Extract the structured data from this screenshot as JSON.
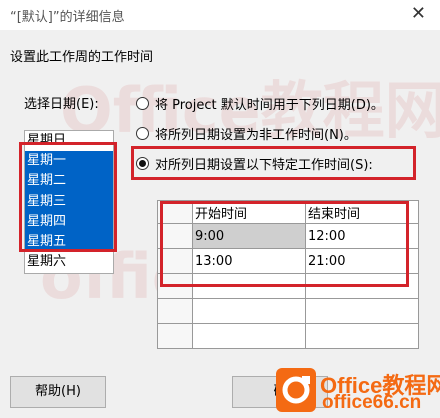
{
  "window": {
    "title": "“[默认]”的详细信息",
    "close_glyph": "✕"
  },
  "watermark": {
    "line1": "Office教程网",
    "line2": "office66.cn"
  },
  "heading": "设置此工作周的工作时间",
  "select_days_label": "选择日期(E):",
  "days": [
    "星期日",
    "星期一",
    "星期二",
    "星期三",
    "星期四",
    "星期五",
    "星期六"
  ],
  "selected_days": [
    "星期一",
    "星期二",
    "星期三",
    "星期四",
    "星期五"
  ],
  "options": [
    {
      "label": "将 Project 默认时间用于下列日期(D)。",
      "selected": false
    },
    {
      "label": "将所列日期设置为非工作时间(N)。",
      "selected": false
    },
    {
      "label": "对所列日期设置以下特定工作时间(S):",
      "selected": true
    }
  ],
  "work_times": {
    "headers": [
      "开始时间",
      "结束时间"
    ],
    "rows": [
      [
        "9:00",
        "12:00"
      ],
      [
        "13:00",
        "21:00"
      ],
      [
        "",
        ""
      ],
      [
        "",
        ""
      ],
      [
        "",
        ""
      ]
    ]
  },
  "buttons": {
    "help": "帮助(H)",
    "ok": "确"
  },
  "logo": {
    "brand": "Office教程网",
    "domain": "office66.cn"
  },
  "colors": {
    "highlight": "#d3232a",
    "selection": "#0063c6",
    "logo": "#f46a13"
  }
}
